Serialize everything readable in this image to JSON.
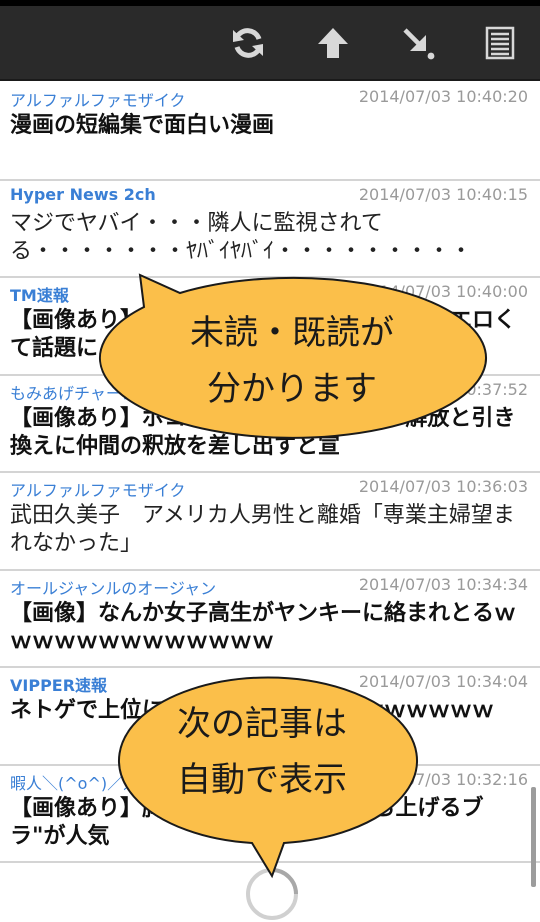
{
  "toolbar": {
    "refresh_icon": "refresh-icon",
    "top_icon": "arrow-up-icon",
    "next_icon": "arrow-down-right-icon",
    "list_icon": "list-icon",
    "background": "#2a2a2a",
    "icon_color": "#d8d8d8"
  },
  "feed": {
    "items": [
      {
        "site": "アルファルファモザイク",
        "date": "2014/07/03 10:40:20",
        "title": "漫画の短編集で面白い漫画"
      },
      {
        "site": "Hyper News 2ch",
        "date": "2014/07/03 10:40:15",
        "title": "マジでヤバイ・・・隣人に監視されてる・・・・・・・ﾔﾊﾞｲﾔﾊﾞｲ・・・・・・・・・"
      },
      {
        "site": "TM速報",
        "date": "2014/07/03 10:40:00",
        "title": "【画像あり】ファッション誌の表紙がマジでエロくて話題に"
      },
      {
        "site": "もみあげチャーシュー",
        "date": "2014/07/03 10:37:52",
        "title": "【画像あり】ボコ・ハラムが女子学生の解放と引き換えに仲間の釈放を差し出すと宣"
      },
      {
        "site": "アルファルファモザイク",
        "date": "2014/07/03 10:36:03",
        "title": "武田久美子　アメリカ人男性と離婚「専業主婦望まれなかった」"
      },
      {
        "site": "オールジャンルのオージャン",
        "date": "2014/07/03 10:34:34",
        "title": "【画像】なんか女子高生がヤンキーに絡まれとるｗｗｗｗｗｗｗｗｗｗｗｗｗ"
      },
      {
        "site": "VIPPER速報",
        "date": "2014/07/03 10:34:04",
        "title": "ネトゲで上位に入った結果ｗｗｗｗｗｗｗｗｗｗ"
      },
      {
        "site": "暇人＼(^o^)／速報",
        "date": "2014/07/03 10:32:16",
        "title": "【画像あり】胸を持ち上げるブラ\"持ち上げるブラ\"が人気"
      }
    ]
  },
  "callouts": {
    "read_status_line1": "未読・既読が",
    "read_status_line2": "分かります",
    "auto_next_line1": "次の記事は",
    "auto_next_line2": "自動で表示",
    "bubble_fill": "#fbbf4a",
    "bubble_stroke": "#1a1a1a"
  },
  "loading": {
    "icon": "loading-spinner-icon"
  }
}
